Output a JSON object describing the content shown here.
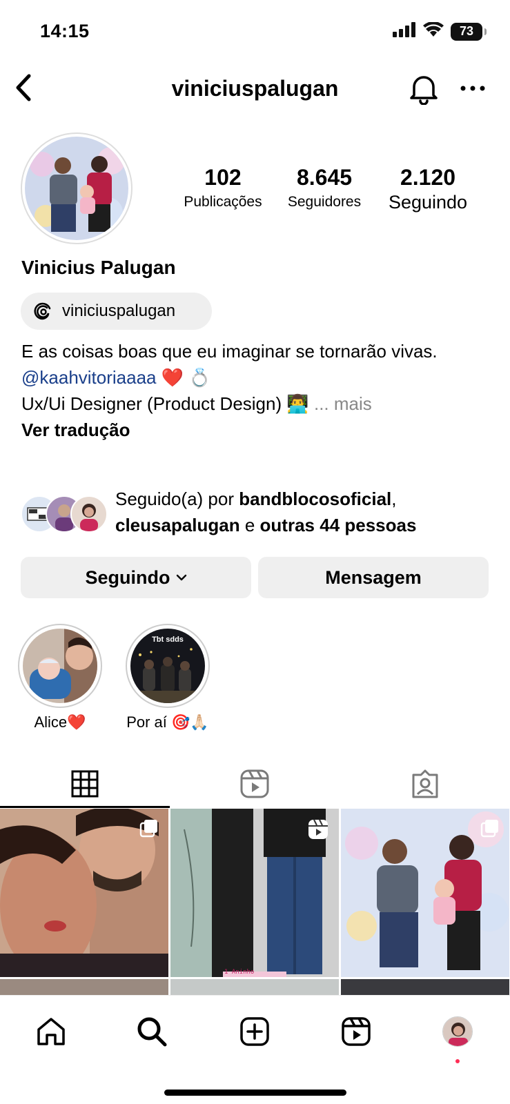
{
  "status": {
    "time": "14:15",
    "battery": "73"
  },
  "header": {
    "username": "viniciuspalugan"
  },
  "profile": {
    "stats": [
      {
        "value": "102",
        "label": "Publicações"
      },
      {
        "value": "8.645",
        "label": "Seguidores"
      },
      {
        "value": "2.120",
        "label": "Seguindo"
      }
    ],
    "name": "Vinicius Palugan",
    "threads_handle": "viniciuspalugan",
    "bio": {
      "line1": "E as coisas boas que eu imaginar se tornarão vivas.",
      "mention": "@kaahvitoriaaaa",
      "mention_emoji": "❤️ 💍",
      "line3": "Ux/Ui Designer (Product Design) 👨‍💻",
      "ellipsis": "...",
      "more": "mais",
      "translate": "Ver tradução"
    },
    "followed_by": {
      "prefix": "Seguido(a) por ",
      "user1": "bandblocosoficial",
      "comma": ",",
      "user2": "cleusapalugan",
      "conj": " e ",
      "others": "outras 44 pessoas"
    }
  },
  "actions": {
    "following_label": "Seguindo",
    "message_label": "Mensagem"
  },
  "highlights": [
    {
      "label": "Alice❤️"
    },
    {
      "label": "Por aí 🎯🙏🏻",
      "overlay_text": "Tbt sdds"
    }
  ],
  "grid": {
    "caption_text": "1 Aninho"
  },
  "colors": {
    "mention": "#1a3f8a",
    "notification_dot": "#ff2d55",
    "button_bg": "#efefef"
  },
  "icons": {
    "status": [
      "signal-icon",
      "wifi-icon",
      "battery-icon"
    ],
    "header": [
      "back-arrow-icon",
      "bell-icon",
      "more-dots-icon"
    ],
    "tabs": [
      "grid-icon",
      "reels-icon",
      "tagged-icon"
    ],
    "nav": [
      "home-icon",
      "search-icon",
      "create-icon",
      "reels-icon",
      "profile-avatar"
    ]
  }
}
